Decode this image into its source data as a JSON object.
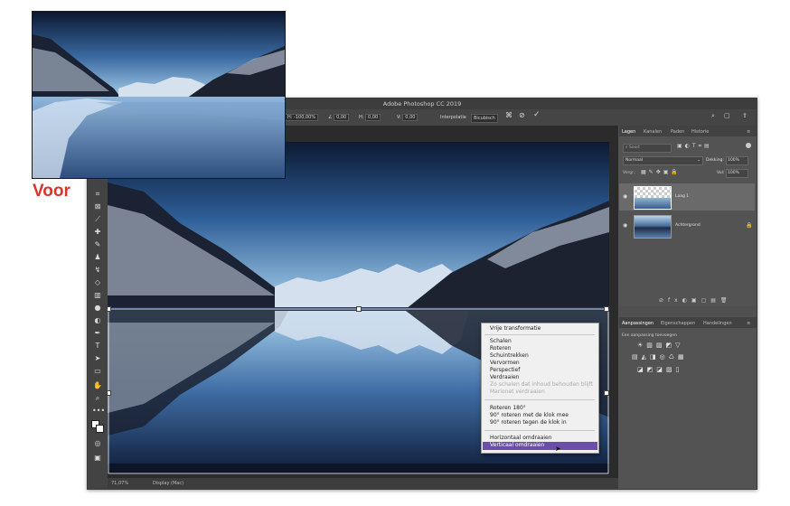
{
  "before_label": "Voor",
  "window": {
    "title": "Adobe Photoshop CC 2019"
  },
  "options_bar": {
    "h_value": "H: -100,00%",
    "angle_value": "0,00",
    "h_skew_label": "H:",
    "h_skew_value": "0,00",
    "v_skew_label": "V:",
    "v_skew_value": "0,00",
    "interpolation_label": "Interpolatie",
    "interpolation_value": "Bicubisch"
  },
  "status_bar": {
    "zoom": "71,07%",
    "info": "Display (Mac)"
  },
  "layers_panel": {
    "tabs": [
      "Lagen",
      "Kanalen",
      "Paden",
      "Historie"
    ],
    "active_tab": "Lagen",
    "filter_placeholder": "Soort",
    "blend_mode": "Normaal",
    "opacity_label": "Dekking:",
    "opacity_value": "100%",
    "lock_label": "Vergr.:",
    "fill_label": "Vul:",
    "fill_value": "100%",
    "layers": [
      {
        "name": "Laag 1"
      },
      {
        "name": "Achtergrond"
      }
    ]
  },
  "adjustments_panel": {
    "tabs": [
      "Aanpassingen",
      "Eigenschappen",
      "Handelingen"
    ],
    "active_tab": "Aanpassingen",
    "hint": "Een aanpassing toevoegen"
  },
  "context_menu": {
    "groups": [
      [
        {
          "label": "Vrije transformatie",
          "disabled": false
        }
      ],
      [
        {
          "label": "Schalen",
          "disabled": false
        },
        {
          "label": "Roteren",
          "disabled": false
        },
        {
          "label": "Schuintrekken",
          "disabled": false
        },
        {
          "label": "Vervormen",
          "disabled": false
        },
        {
          "label": "Perspectief",
          "disabled": false
        },
        {
          "label": "Verdraaien",
          "disabled": false
        },
        {
          "label": "Zo schalen dat inhoud behouden blijft",
          "disabled": true
        },
        {
          "label": "Marionet verdraaien",
          "disabled": true
        }
      ],
      [
        {
          "label": "Roteren 180°",
          "disabled": false
        },
        {
          "label": "90° roteren met de klok mee",
          "disabled": false
        },
        {
          "label": "90° roteren tegen de klok in",
          "disabled": false
        }
      ],
      [
        {
          "label": "Horizontaal omdraaien",
          "disabled": false
        },
        {
          "label": "Verticaal omdraaien",
          "disabled": false,
          "selected": true
        }
      ]
    ]
  },
  "colors": {
    "menu_highlight": "#6b4fa6",
    "before_label": "#d9352b",
    "panel_bg": "#505050"
  }
}
